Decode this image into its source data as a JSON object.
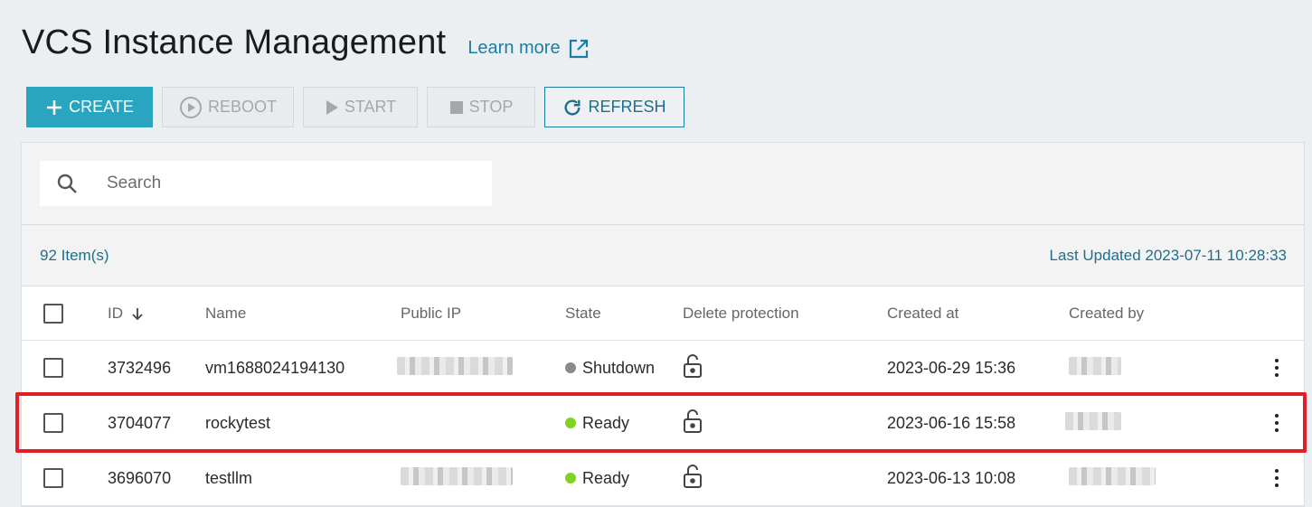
{
  "header": {
    "title": "VCS Instance Management",
    "learn_more": "Learn more"
  },
  "toolbar": {
    "create": "CREATE",
    "reboot": "REBOOT",
    "start": "START",
    "stop": "STOP",
    "refresh": "REFRESH"
  },
  "search": {
    "placeholder": "Search"
  },
  "info": {
    "count": "92 Item(s)",
    "last_updated": "Last Updated 2023-07-11 10:28:33"
  },
  "table": {
    "columns": {
      "id": "ID",
      "name": "Name",
      "public_ip": "Public IP",
      "state": "State",
      "delete_protection": "Delete protection",
      "created_at": "Created at",
      "created_by": "Created by"
    },
    "rows": [
      {
        "id": "3732496",
        "name": "vm1688024194130",
        "state": "Shutdown",
        "created_at": "2023-06-29 15:36"
      },
      {
        "id": "3704077",
        "name": "rockytest",
        "state": "Ready",
        "created_at": "2023-06-16 15:58"
      },
      {
        "id": "3696070",
        "name": "testllm",
        "state": "Ready",
        "created_at": "2023-06-13 10:08"
      }
    ]
  },
  "colors": {
    "accent": "#2aa5bf",
    "link": "#1d7ea3",
    "status_shutdown": "#8a8a8a",
    "status_ready": "#7ed321",
    "highlight": "#e41e26"
  },
  "icons": {
    "learn_more": "external-link-icon",
    "create": "plus-icon",
    "reboot": "play-circle-icon",
    "start": "play-icon",
    "stop": "stop-icon",
    "refresh": "refresh-icon",
    "search": "search-icon",
    "sort": "arrow-down-icon",
    "delete_protection": "unlock-icon",
    "row_menu": "kebab-menu-icon"
  }
}
